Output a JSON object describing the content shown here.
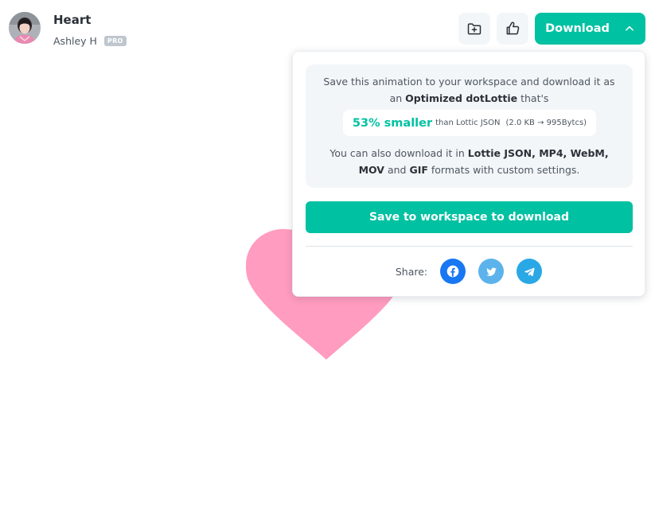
{
  "animation": {
    "title": "Heart",
    "author": "Ashley H",
    "badge": "PRO"
  },
  "toolbar": {
    "collection_icon": "folder-plus-icon",
    "like_icon": "thumbs-up-icon",
    "download_label": "Download",
    "download_icon": "chevron-up-icon"
  },
  "download_panel": {
    "intro_line1": "Save this animation to your workspace and download it as",
    "intro_line2_prefix": "an ",
    "intro_line2_bold": "Optimized dotLottie",
    "intro_line2_suffix": " that's",
    "savings_highlight": "53% smaller",
    "savings_comparison": "than Lottic JSON",
    "savings_detail": "(2.0 KB → 995Bytcs)",
    "formats_line1_prefix": "You can also download it in ",
    "formats_line1_bold": "Lottie JSON, MP4, WebM,",
    "formats_line2_bold1": "MOV",
    "formats_line2_mid": " and ",
    "formats_line2_bold2": "GIF",
    "formats_line2_suffix": " formats with custom settings.",
    "save_button_label": "Save to workspace to download",
    "share_label": "Share:",
    "share_icons": [
      "facebook-icon",
      "twitter-icon",
      "telegram-icon"
    ]
  },
  "colors": {
    "accent": "#00c1a2",
    "heart": "#ff9cbf",
    "facebook": "#1877f2",
    "twitter": "#5cb3ec",
    "telegram": "#2aa8e6",
    "panel_bg": "#f3f6f8"
  }
}
